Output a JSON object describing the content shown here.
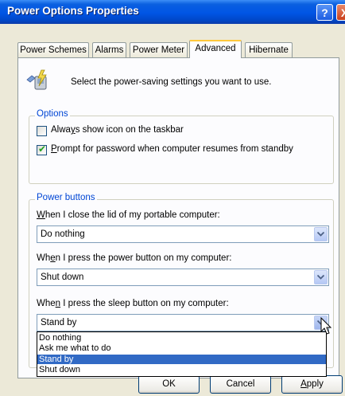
{
  "window": {
    "title": "Power Options Properties",
    "help_glyph": "?",
    "close_glyph": "X"
  },
  "tabs": [
    {
      "label": "Power Schemes",
      "active": false
    },
    {
      "label": "Alarms",
      "active": false
    },
    {
      "label": "Power Meter",
      "active": false
    },
    {
      "label": "Advanced",
      "active": true
    },
    {
      "label": "Hibernate",
      "active": false
    }
  ],
  "header": {
    "icon": "power-settings-icon",
    "text": "Select the power-saving settings you want to use."
  },
  "options": {
    "legend": "Options",
    "show_icon": {
      "pre": "Alwa",
      "underline": "y",
      "post": "s show icon on the taskbar",
      "checked": false
    },
    "prompt_password": {
      "pre": "",
      "underline": "P",
      "post": "rompt for password when computer resumes from standby",
      "checked": true
    }
  },
  "power_buttons": {
    "legend": "Power buttons",
    "lid": {
      "label_underline": "W",
      "label_post": "hen I close the lid of my portable computer:",
      "value": "Do nothing"
    },
    "power": {
      "label_pre": "Wh",
      "label_underline": "e",
      "label_post": "n I press the power button on my computer:",
      "value": "Shut down"
    },
    "sleep": {
      "label_pre": "Whe",
      "label_underline": "n",
      "label_post": " I press the sleep button on my computer:",
      "value": "Stand by"
    }
  },
  "dropdown": {
    "options": [
      "Do nothing",
      "Ask me what to do",
      "Stand by",
      "Shut down"
    ],
    "selected_index": 2
  },
  "buttons": {
    "ok": "OK",
    "cancel": "Cancel",
    "apply_underline": "A",
    "apply_post": "pply"
  },
  "colors": {
    "titlebar": "#0055e5",
    "group_legend": "#0046d5",
    "selection": "#316ac5",
    "tab_highlight": "#ffc83c"
  }
}
